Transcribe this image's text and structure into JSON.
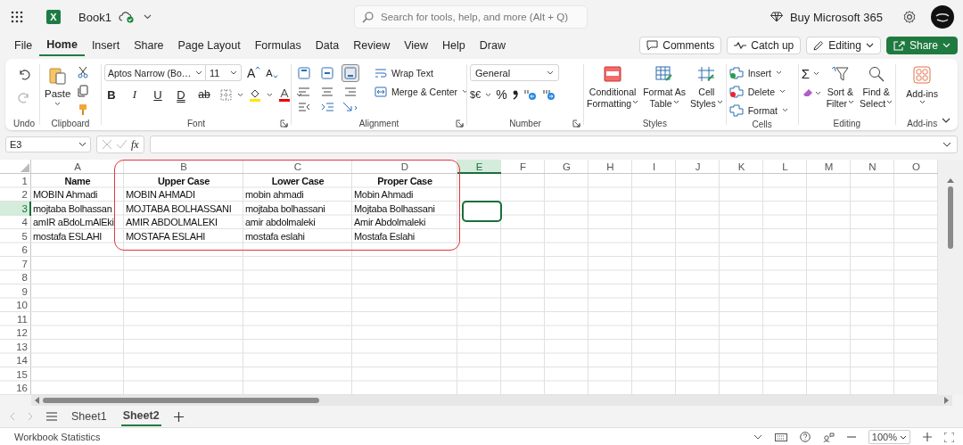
{
  "top_bar": {
    "logo": "X",
    "title": "Book1",
    "search": {
      "placeholder": "Search for tools, help, and more (Alt + Q)"
    },
    "buy": "Buy Microsoft 365"
  },
  "menu_tabs": [
    {
      "label": "File",
      "selected": false
    },
    {
      "label": "Home",
      "selected": true
    },
    {
      "label": "Insert",
      "selected": false
    },
    {
      "label": "Share",
      "selected": false
    },
    {
      "label": "Page Layout",
      "selected": false
    },
    {
      "label": "Formulas",
      "selected": false
    },
    {
      "label": "Data",
      "selected": false
    },
    {
      "label": "Review",
      "selected": false
    },
    {
      "label": "View",
      "selected": false
    },
    {
      "label": "Help",
      "selected": false
    },
    {
      "label": "Draw",
      "selected": false
    }
  ],
  "actions": [
    {
      "label": "Comments",
      "kind": "comments"
    },
    {
      "label": "Catch up",
      "kind": "catchup"
    },
    {
      "label": "Editing",
      "kind": "editing"
    },
    {
      "label": "Share",
      "kind": "share"
    }
  ],
  "ribbon": [
    {
      "kind": "undo",
      "label": "Undo"
    },
    {
      "kind": "clipboard",
      "label": "Clipboard",
      "paste": "Paste"
    },
    {
      "kind": "font",
      "label": "Font",
      "font": "Aptos Narrow (Bo…",
      "size": "11",
      "grow": "A",
      "shrink": "A",
      "styles": [
        "B",
        "I",
        "U",
        "D",
        "ab"
      ]
    },
    {
      "kind": "alignment",
      "label": "Alignment",
      "vertical": [
        {
          "selected": false
        },
        {
          "selected": false
        },
        {
          "selected": true
        }
      ],
      "wrap": "Wrap Text",
      "merge": "Merge & Center"
    },
    {
      "kind": "number",
      "label": "Number",
      "format": "General",
      "currency": "$€",
      "percent": "%"
    },
    {
      "kind": "styles",
      "label": "Styles",
      "buttons": [
        [
          "Conditional",
          "Formatting"
        ],
        [
          "Format As",
          "Table"
        ],
        [
          "Cell",
          "Styles"
        ]
      ]
    },
    {
      "kind": "cells",
      "label": "Cells",
      "buttons": [
        "Insert",
        "Delete",
        "Format"
      ]
    },
    {
      "kind": "editing",
      "label": "Editing",
      "sum": "Σ",
      "buttons": [
        [
          "Sort &",
          "Filter"
        ],
        [
          "Find &",
          "Select"
        ]
      ]
    },
    {
      "kind": "addins",
      "label": "Add-ins",
      "button": "Add-ins"
    }
  ],
  "formula_bar": {
    "name_box": "E3",
    "function_label": "fx"
  },
  "columns": [
    {
      "label": "A",
      "selected": false
    },
    {
      "label": "B",
      "selected": false
    },
    {
      "label": "C",
      "selected": false
    },
    {
      "label": "D",
      "selected": false
    },
    {
      "label": "E",
      "selected": true
    },
    {
      "label": "F",
      "selected": false
    },
    {
      "label": "G",
      "selected": false
    },
    {
      "label": "H",
      "selected": false
    },
    {
      "label": "I",
      "selected": false
    },
    {
      "label": "J",
      "selected": false
    },
    {
      "label": "K",
      "selected": false
    },
    {
      "label": "L",
      "selected": false
    },
    {
      "label": "M",
      "selected": false
    },
    {
      "label": "N",
      "selected": false
    },
    {
      "label": "O",
      "selected": false
    }
  ],
  "rows": [
    {
      "number": "1",
      "selected": false,
      "kind": "header",
      "cells": [
        "Name",
        "Upper Case",
        "Lower Case",
        "Proper Case"
      ]
    },
    {
      "number": "2",
      "selected": false,
      "kind": "data",
      "cells": [
        "MOBIN Ahmadi",
        "MOBIN AHMADI",
        "mobin ahmadi",
        "Mobin Ahmadi"
      ]
    },
    {
      "number": "3",
      "selected": true,
      "kind": "data",
      "cells": [
        "mojtaba Bolhassan",
        "MOJTABA BOLHASSANI",
        "mojtaba bolhassani",
        "Mojtaba Bolhassani"
      ]
    },
    {
      "number": "4",
      "selected": false,
      "kind": "data",
      "cells": [
        "amIR aBdoLmAlEki",
        "AMIR ABDOLMALEKI",
        "amir abdolmaleki",
        "Amir Abdolmaleki"
      ]
    },
    {
      "number": "5",
      "selected": false,
      "kind": "data",
      "cells": [
        "mostafa ESLAHI",
        "MOSTAFA ESLAHI",
        "mostafa eslahi",
        "Mostafa Eslahi"
      ]
    },
    {
      "number": "6",
      "selected": false
    },
    {
      "number": "7",
      "selected": false
    },
    {
      "number": "8",
      "selected": false
    },
    {
      "number": "9",
      "selected": false
    },
    {
      "number": "10",
      "selected": false
    },
    {
      "number": "11",
      "selected": false
    },
    {
      "number": "12",
      "selected": false
    },
    {
      "number": "13",
      "selected": false
    },
    {
      "number": "14",
      "selected": false
    },
    {
      "number": "15",
      "selected": false
    },
    {
      "number": "16",
      "selected": false
    }
  ],
  "sheet_tabs": [
    {
      "label": "Sheet1",
      "selected": false
    },
    {
      "label": "Sheet2",
      "selected": true
    }
  ],
  "status_bar": {
    "text": "Workbook Statistics",
    "zoom": "100%"
  }
}
